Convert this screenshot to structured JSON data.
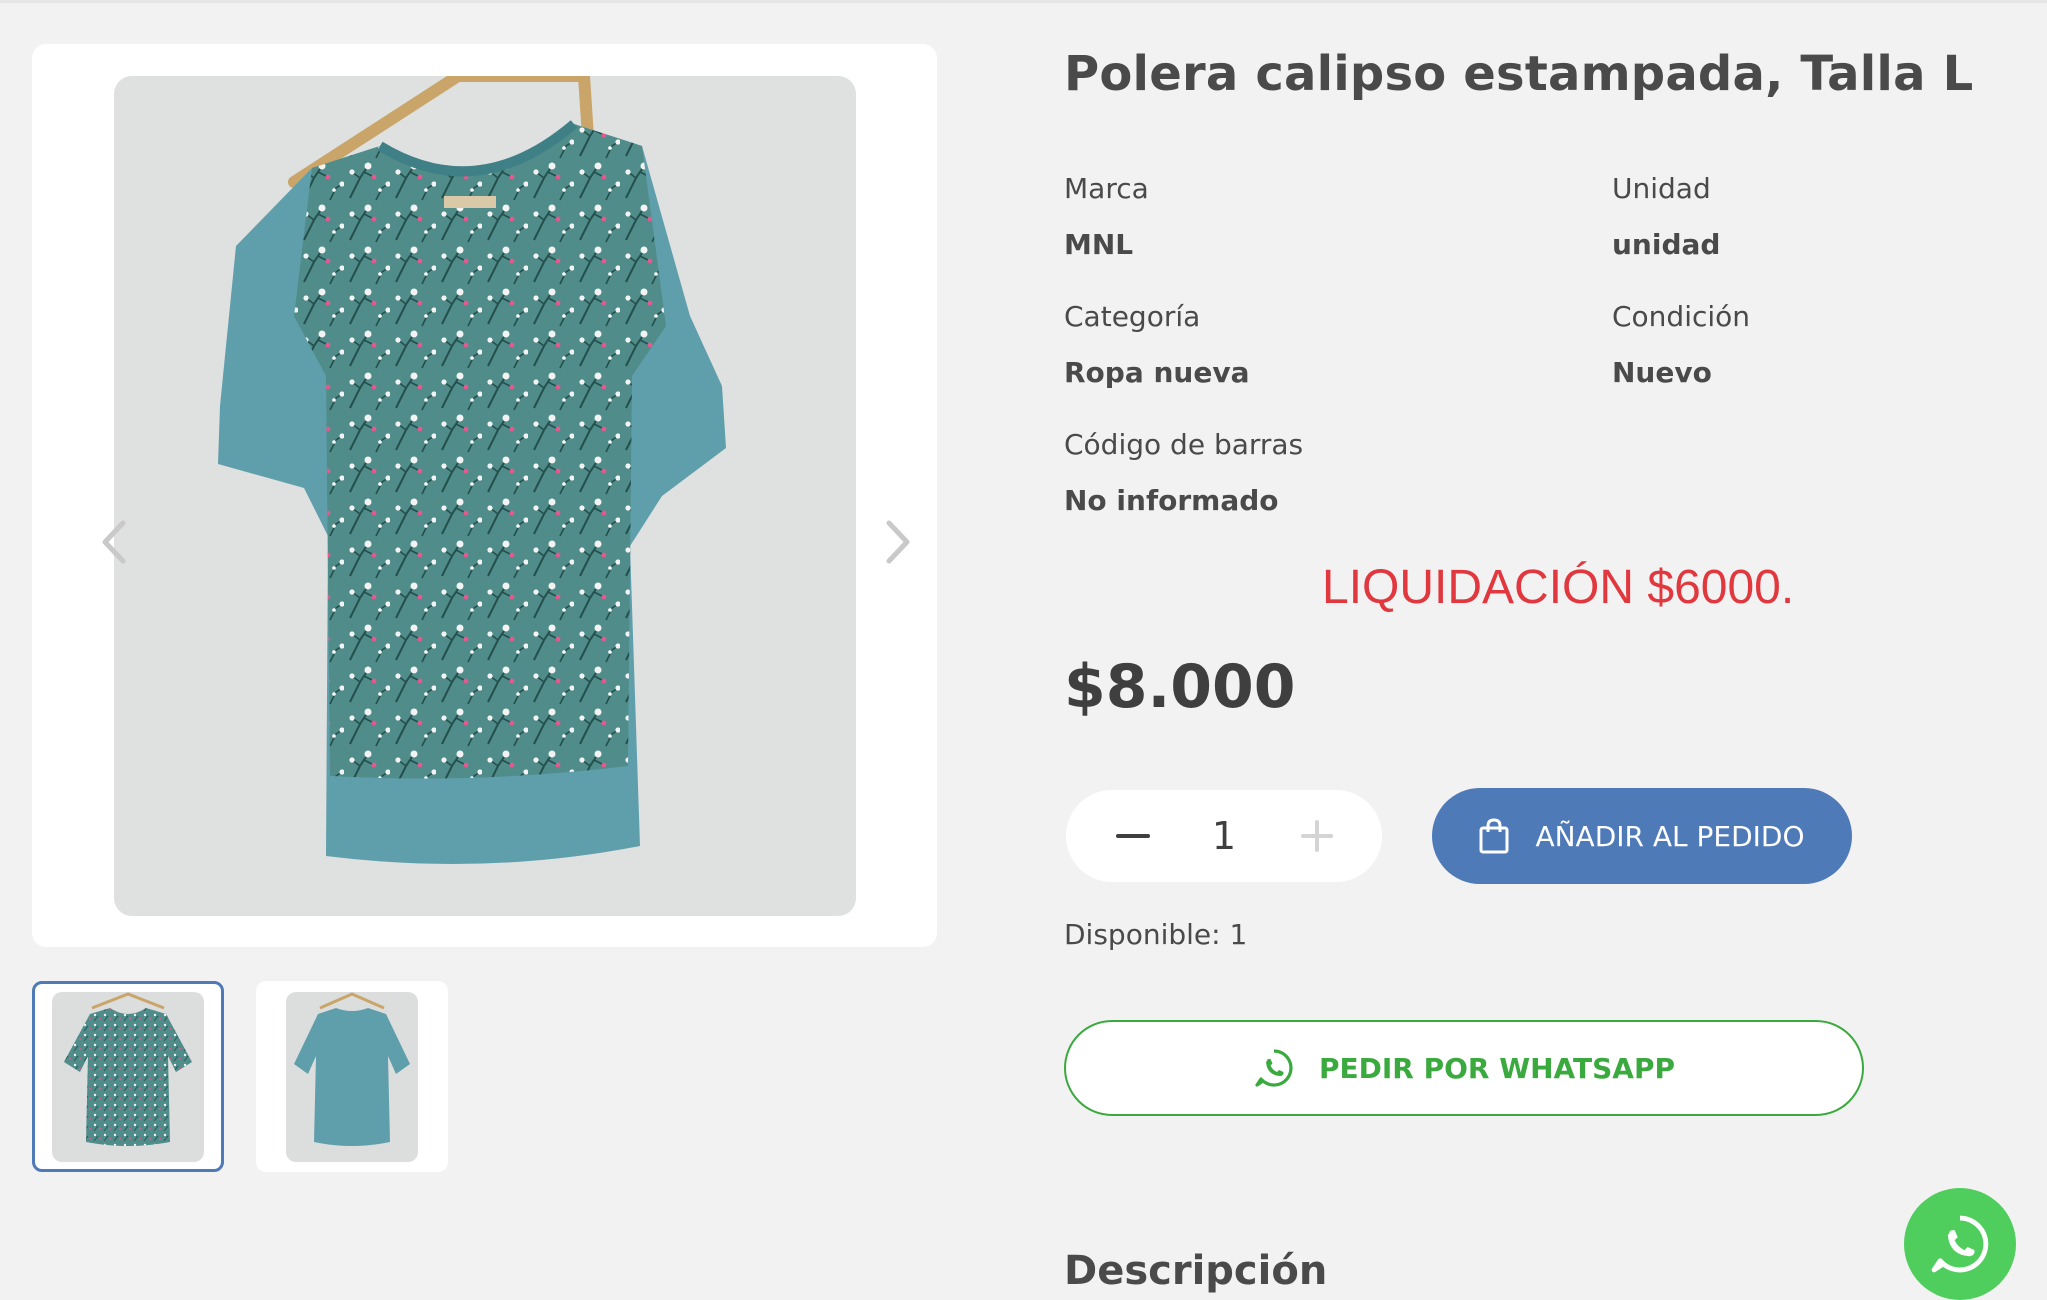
{
  "product": {
    "title": "Polera calipso estampada, Talla L",
    "attributes": [
      {
        "label": "Marca",
        "value": "MNL"
      },
      {
        "label": "Unidad",
        "value": "unidad"
      },
      {
        "label": "Categoría",
        "value": "Ropa nueva"
      },
      {
        "label": "Condición",
        "value": "Nuevo"
      },
      {
        "label": "Código de barras",
        "value": "No informado"
      }
    ],
    "promo_text": "LIQUIDACIÓN $6000.",
    "price": "$8.000",
    "quantity": "1",
    "stock": "Disponible: 1"
  },
  "gallery": {
    "images": [
      {
        "icon": "floral-shirt-front-photo"
      },
      {
        "icon": "plain-shirt-back-photo"
      }
    ],
    "selected_index": 0
  },
  "actions": {
    "add_label": "AÑADIR AL PEDIDO",
    "whatsapp_label": "PEDIR POR WHATSAPP"
  },
  "sections": {
    "description_title": "Descripción"
  },
  "colors": {
    "primary": "#4f7ab8",
    "whatsapp": "#3aaa3f",
    "whatsapp_float": "#4fce5d",
    "promo": "#e0383e",
    "background": "#f2f2f2"
  }
}
